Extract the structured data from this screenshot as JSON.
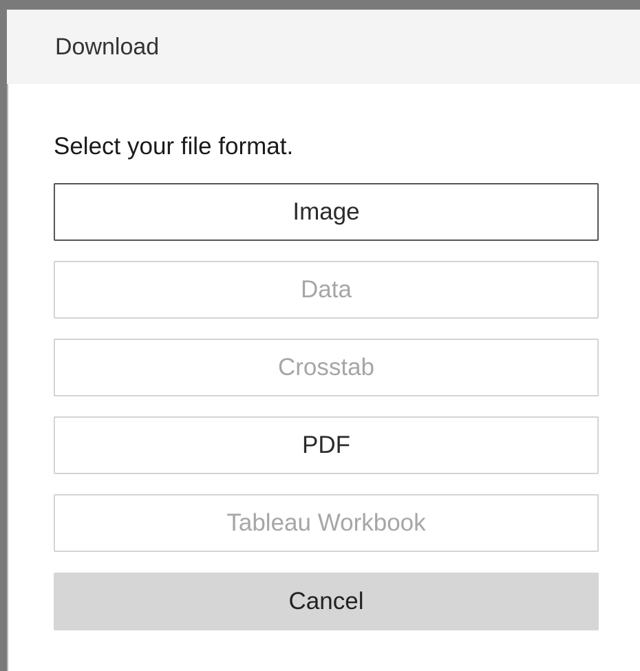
{
  "dialog": {
    "title": "Download",
    "prompt": "Select your file format.",
    "options": [
      {
        "label": "Image",
        "enabled": true,
        "selected": true
      },
      {
        "label": "Data",
        "enabled": false,
        "selected": false
      },
      {
        "label": "Crosstab",
        "enabled": false,
        "selected": false
      },
      {
        "label": "PDF",
        "enabled": true,
        "selected": false
      },
      {
        "label": "Tableau Workbook",
        "enabled": false,
        "selected": false
      }
    ],
    "cancel_label": "Cancel"
  }
}
